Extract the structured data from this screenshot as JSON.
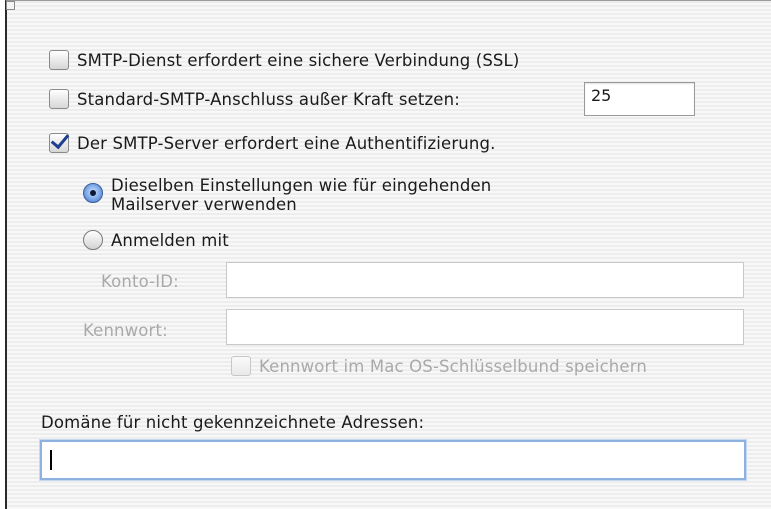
{
  "smtp": {
    "ssl_label": "SMTP-Dienst erfordert eine sichere Verbindung (SSL)",
    "ssl_checked": false,
    "override_port_label": "Standard-SMTP-Anschluss außer Kraft setzen:",
    "override_port_checked": false,
    "port_value": "25",
    "auth_label": "Der SMTP-Server erfordert eine Authentifizierung.",
    "auth_checked": true
  },
  "auth_options": {
    "same_settings_line1": "Dieselben Einstellungen wie für eingehenden",
    "same_settings_line2": "Mailserver verwenden",
    "same_settings_selected": true,
    "login_with_label": "Anmelden mit",
    "login_with_selected": false
  },
  "credentials": {
    "account_id_label": "Konto-ID:",
    "account_id_value": "",
    "password_label": "Kennwort:",
    "password_value": "",
    "keychain_label": "Kennwort im Mac OS-Schlüsselbund speichern",
    "keychain_checked": false
  },
  "domain": {
    "label": "Domäne für nicht gekennzeichnete Adressen:",
    "value": ""
  }
}
